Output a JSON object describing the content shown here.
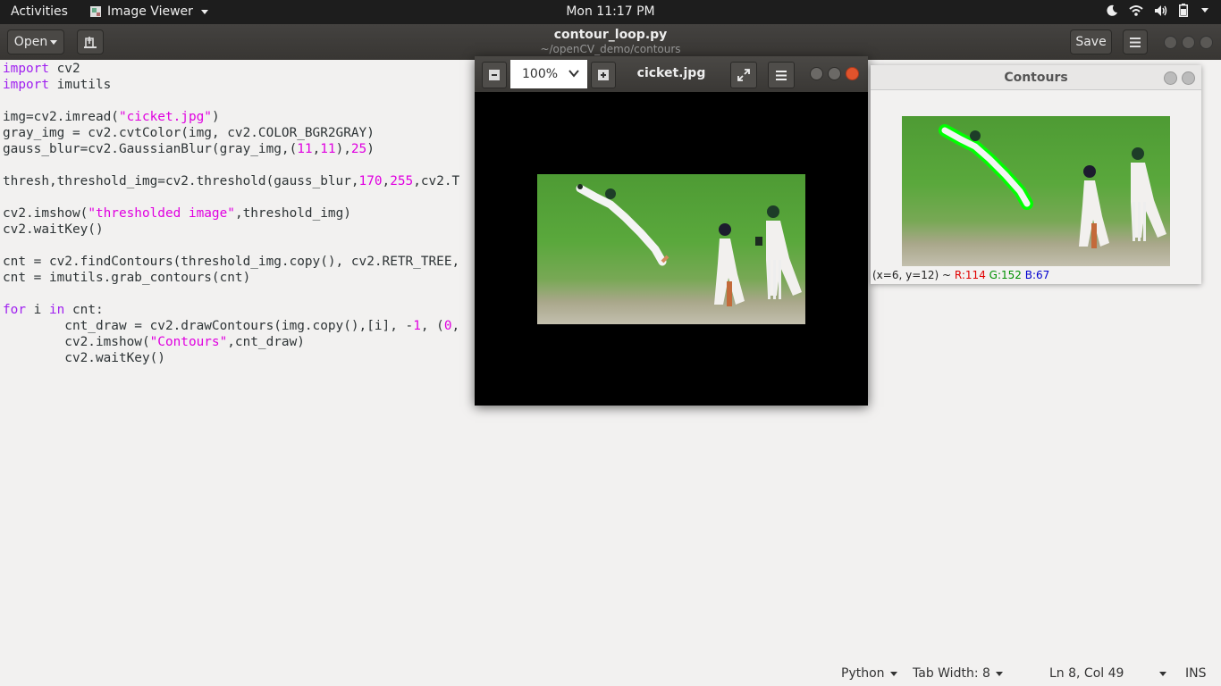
{
  "topbar": {
    "activities": "Activities",
    "app_name": "Image Viewer",
    "clock": "Mon 11:17 PM"
  },
  "gedit": {
    "open_label": "Open",
    "title": "contour_loop.py",
    "subtitle": "~/openCV_demo/contours",
    "save_label": "Save"
  },
  "code_lines": [
    "import cv2",
    "import imutils",
    "",
    "img=cv2.imread(\"cicket.jpg\")",
    "gray_img = cv2.cvtColor(img, cv2.COLOR_BGR2GRAY)",
    "gauss_blur=cv2.GaussianBlur(gray_img,(11,11),25)",
    "",
    "thresh,threshold_img=cv2.threshold(gauss_blur,170,255,cv2.T",
    "",
    "cv2.imshow(\"thresholded image\",threshold_img)",
    "cv2.waitKey()",
    "",
    "cnt = cv2.findContours(threshold_img.copy(), cv2.RETR_TREE,",
    "cnt = imutils.grab_contours(cnt)",
    "",
    "for i in cnt:",
    "        cnt_draw = cv2.drawContours(img.copy(),[i], -1, (0,",
    "        cv2.imshow(\"Contours\",cnt_draw)",
    "        cv2.waitKey()"
  ],
  "statusbar": {
    "language": "Python",
    "tab_width": "Tab Width: 8",
    "position": "Ln 8, Col 49",
    "mode": "INS"
  },
  "viewer": {
    "zoom": "100%",
    "title": "cicket.jpg"
  },
  "contours_window": {
    "title": "Contours",
    "pixel_coords": "(x=6, y=12) ~",
    "r": "R:114",
    "g": "G:152",
    "b": "B:67"
  },
  "colors": {
    "keyword": "#a020f0",
    "string": "#e000e0",
    "contour": "#00ff00"
  }
}
